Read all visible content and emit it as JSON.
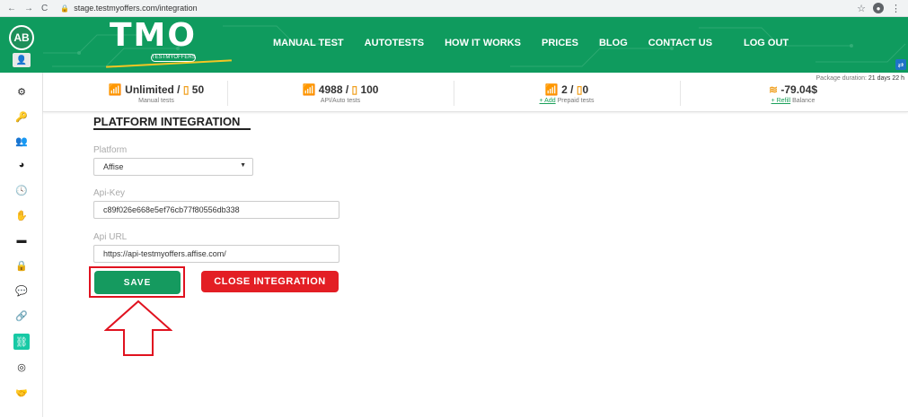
{
  "browser": {
    "back": "←",
    "forward": "→",
    "reload": "C",
    "url": "stage.testmyoffers.com/integration",
    "star": "☆",
    "menu": "⋮"
  },
  "sidebar": {
    "avatar_initials": "AB",
    "items": [
      {
        "icon": "gears-icon"
      },
      {
        "icon": "key-icon"
      },
      {
        "icon": "users-icon"
      },
      {
        "icon": "pie-chart-icon"
      },
      {
        "icon": "clock-icon"
      },
      {
        "icon": "hand-coin-icon"
      },
      {
        "icon": "credit-card-icon"
      },
      {
        "icon": "lock-icon"
      },
      {
        "icon": "comments-icon"
      },
      {
        "icon": "link-icon"
      },
      {
        "icon": "integration-icon",
        "active": true
      },
      {
        "icon": "globe-icon"
      },
      {
        "icon": "handshake-icon"
      }
    ]
  },
  "header": {
    "logo_text": "TMO",
    "logo_sub": "TESTMYOFFERS",
    "nav": [
      "MANUAL TEST",
      "AUTOTESTS",
      "HOW IT WORKS",
      "PRICES",
      "BLOG",
      "CONTACT US"
    ],
    "logout": "LOG OUT"
  },
  "stats": {
    "manual": {
      "main": "Unlimited / ",
      "count": "50",
      "sub": "Manual tests"
    },
    "api": {
      "main": "4988 / ",
      "count": "100",
      "sub": "API/Auto tests"
    },
    "prepaid": {
      "main": "2 / ",
      "count": "0",
      "link": "+ Add",
      "sub": "Prepaid tests"
    },
    "balance": {
      "main": "-79.04$",
      "link": "+ Refill",
      "sub": "Balance"
    },
    "package_label": "Package duration:",
    "package_value": "21 days 22 h"
  },
  "form": {
    "title": "PLATFORM INTEGRATION",
    "platform_label": "Platform",
    "platform_value": "Affise",
    "api_key_label": "Api-Key",
    "api_key_value": "c89f026e668e5ef76cb77f80556db338",
    "api_url_label": "Api URL",
    "api_url_value": "https://api-testmyoffers.affise.com/",
    "save_label": "SAVE",
    "close_label": "CLOSE INTEGRATION"
  },
  "colors": {
    "brand_green": "#0f9b5e",
    "save_green": "#159a5f",
    "close_red": "#e31e24",
    "highlight_red": "#e0121f",
    "active_teal": "#17c9a5"
  }
}
